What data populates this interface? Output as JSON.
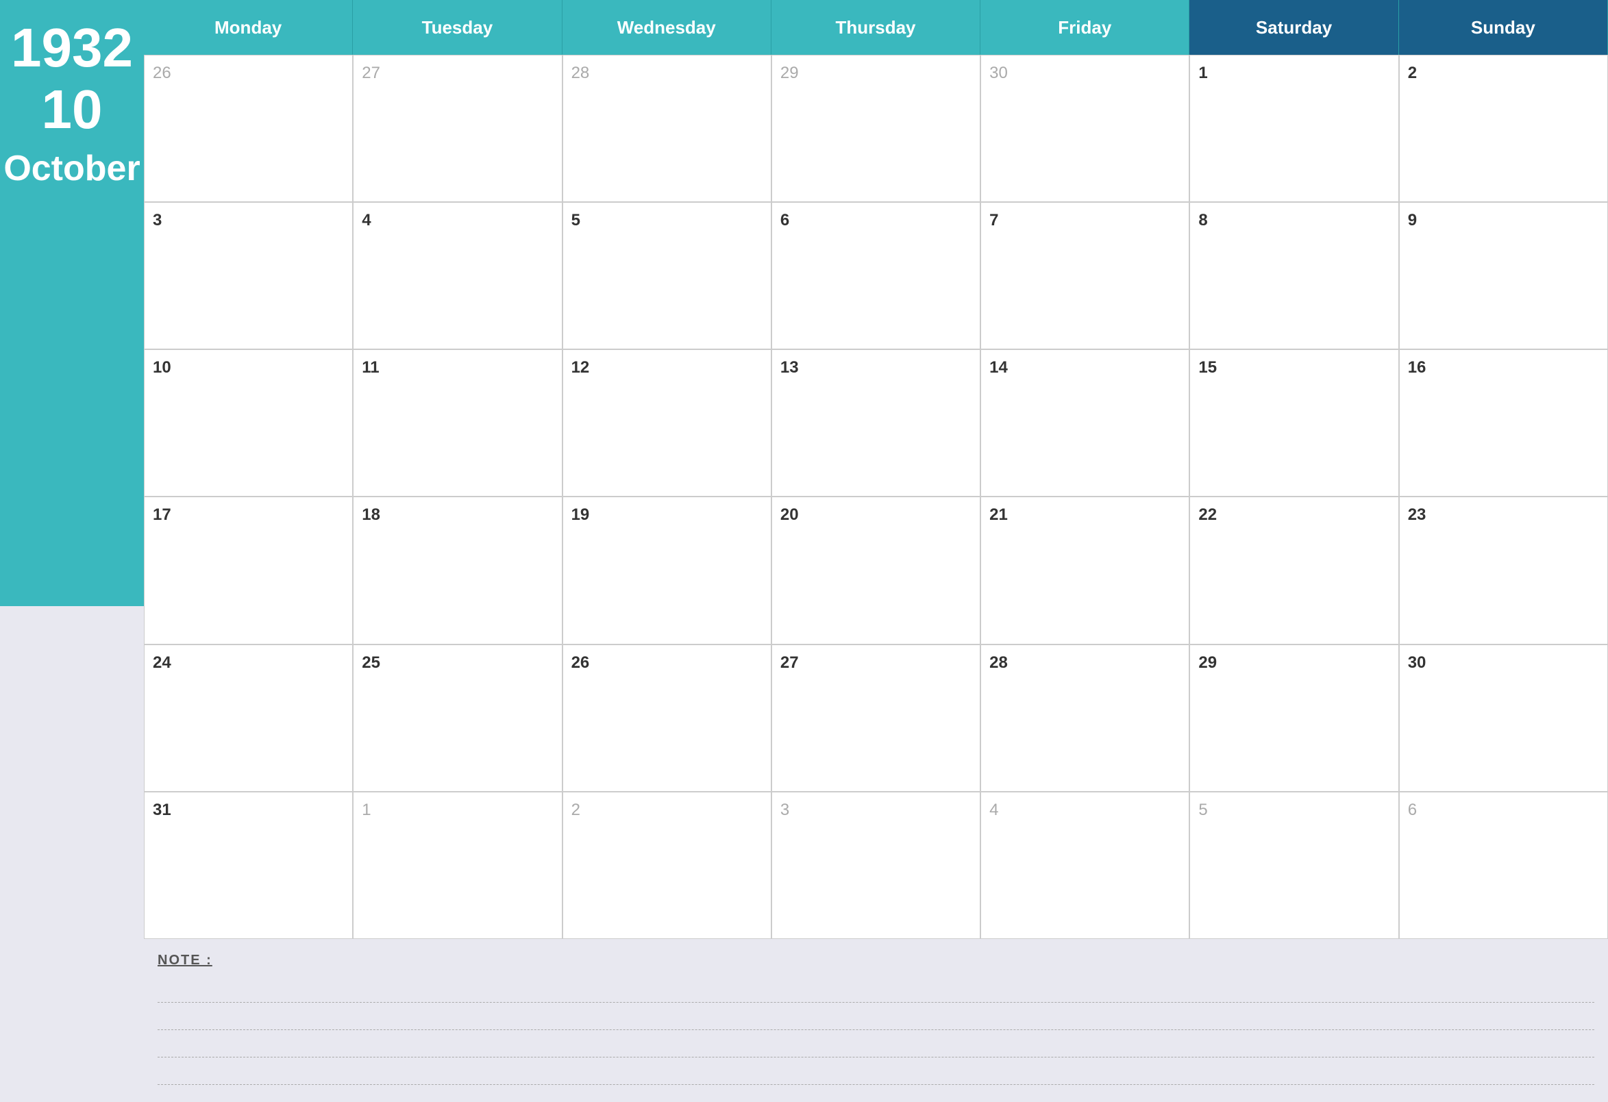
{
  "sidebar": {
    "year": "1932",
    "week_number": "10",
    "month": "October"
  },
  "headers": {
    "days": [
      {
        "label": "Monday",
        "type": "weekday"
      },
      {
        "label": "Tuesday",
        "type": "weekday"
      },
      {
        "label": "Wednesday",
        "type": "weekday"
      },
      {
        "label": "Thursday",
        "type": "weekday"
      },
      {
        "label": "Friday",
        "type": "weekday"
      },
      {
        "label": "Saturday",
        "type": "weekend"
      },
      {
        "label": "Sunday",
        "type": "weekend"
      }
    ]
  },
  "weeks": [
    {
      "days": [
        {
          "number": "26",
          "outside": true
        },
        {
          "number": "27",
          "outside": true
        },
        {
          "number": "28",
          "outside": true
        },
        {
          "number": "29",
          "outside": true
        },
        {
          "number": "30",
          "outside": true
        },
        {
          "number": "1",
          "outside": false
        },
        {
          "number": "2",
          "outside": false
        }
      ]
    },
    {
      "days": [
        {
          "number": "3",
          "outside": false
        },
        {
          "number": "4",
          "outside": false
        },
        {
          "number": "5",
          "outside": false
        },
        {
          "number": "6",
          "outside": false
        },
        {
          "number": "7",
          "outside": false
        },
        {
          "number": "8",
          "outside": false
        },
        {
          "number": "9",
          "outside": false
        }
      ]
    },
    {
      "days": [
        {
          "number": "10",
          "outside": false
        },
        {
          "number": "11",
          "outside": false
        },
        {
          "number": "12",
          "outside": false
        },
        {
          "number": "13",
          "outside": false
        },
        {
          "number": "14",
          "outside": false
        },
        {
          "number": "15",
          "outside": false
        },
        {
          "number": "16",
          "outside": false
        }
      ]
    },
    {
      "days": [
        {
          "number": "17",
          "outside": false
        },
        {
          "number": "18",
          "outside": false
        },
        {
          "number": "19",
          "outside": false
        },
        {
          "number": "20",
          "outside": false
        },
        {
          "number": "21",
          "outside": false
        },
        {
          "number": "22",
          "outside": false
        },
        {
          "number": "23",
          "outside": false
        }
      ]
    },
    {
      "days": [
        {
          "number": "24",
          "outside": false
        },
        {
          "number": "25",
          "outside": false
        },
        {
          "number": "26",
          "outside": false
        },
        {
          "number": "27",
          "outside": false
        },
        {
          "number": "28",
          "outside": false
        },
        {
          "number": "29",
          "outside": false
        },
        {
          "number": "30",
          "outside": false
        }
      ]
    },
    {
      "days": [
        {
          "number": "31",
          "outside": false
        },
        {
          "number": "1",
          "outside": true
        },
        {
          "number": "2",
          "outside": true
        },
        {
          "number": "3",
          "outside": true
        },
        {
          "number": "4",
          "outside": true
        },
        {
          "number": "5",
          "outside": true
        },
        {
          "number": "6",
          "outside": true
        }
      ]
    }
  ],
  "notes": {
    "label": "NOTE :",
    "lines": 4
  }
}
